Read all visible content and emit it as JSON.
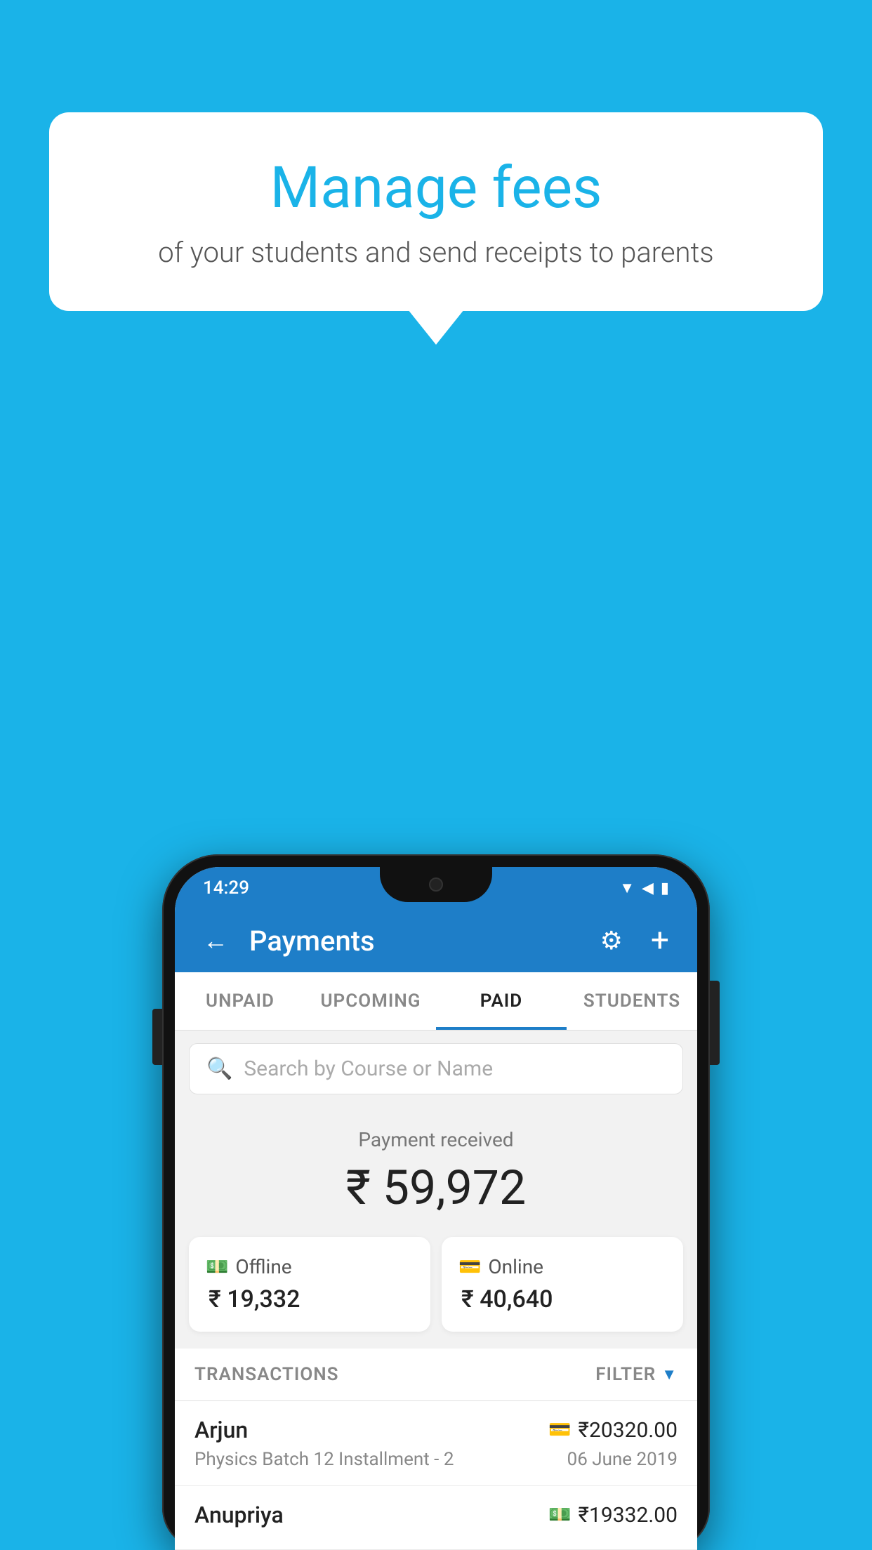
{
  "background": {
    "color": "#1ab3e8"
  },
  "speech_bubble": {
    "title": "Manage fees",
    "subtitle": "of your students and send receipts to parents"
  },
  "status_bar": {
    "time": "14:29",
    "wifi": "▲",
    "signal": "▲",
    "battery": "▮"
  },
  "app_header": {
    "title": "Payments",
    "back_label": "←",
    "gear_label": "⚙",
    "plus_label": "+"
  },
  "tabs": [
    {
      "label": "UNPAID",
      "active": false
    },
    {
      "label": "UPCOMING",
      "active": false
    },
    {
      "label": "PAID",
      "active": true
    },
    {
      "label": "STUDENTS",
      "active": false
    }
  ],
  "search": {
    "placeholder": "Search by Course or Name"
  },
  "payment_summary": {
    "label": "Payment received",
    "amount": "₹ 59,972",
    "offline_label": "Offline",
    "offline_amount": "₹ 19,332",
    "online_label": "Online",
    "online_amount": "₹ 40,640"
  },
  "transactions": {
    "header_label": "TRANSACTIONS",
    "filter_label": "FILTER",
    "items": [
      {
        "name": "Arjun",
        "amount": "₹20320.00",
        "course": "Physics Batch 12 Installment - 2",
        "date": "06 June 2019",
        "icon_type": "card"
      },
      {
        "name": "Anupriya",
        "amount": "₹19332.00",
        "course": "",
        "date": "",
        "icon_type": "cash"
      }
    ]
  }
}
